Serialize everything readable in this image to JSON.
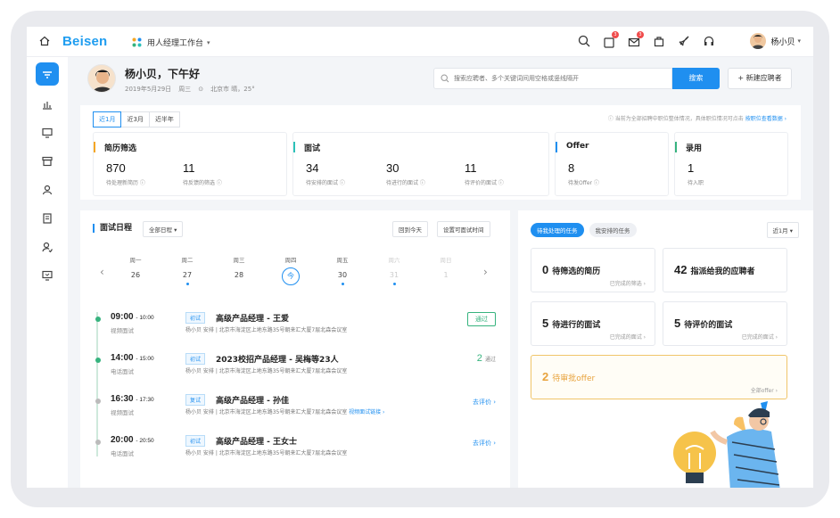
{
  "topbar": {
    "logo": "Beisen",
    "workspace": "用人经理工作台",
    "badges": {
      "mail": "3",
      "msg": "3"
    },
    "user_name": "杨小贝"
  },
  "greeting": {
    "title": "杨小贝，下午好",
    "date": "2019年5月29日",
    "weekday": "周三",
    "weather": "北京市 晴，25°"
  },
  "search": {
    "placeholder": "搜索应聘者、多个关键词间用空格或竖线隔开",
    "button": "搜索",
    "new_button": "+ 新建应聘者"
  },
  "periods": [
    "近1月",
    "近3月",
    "近半年"
  ],
  "hint": {
    "text": "当前为全部招聘中职位整体情况，具体职位情况可点击",
    "link": "按职位查看数据 ›"
  },
  "stats": [
    {
      "title": "简历筛选",
      "color": "#f5a623",
      "metrics": [
        {
          "n": "870",
          "l": "待处理新简历"
        },
        {
          "n": "11",
          "l": "待反馈的筛选"
        }
      ]
    },
    {
      "title": "面试",
      "color": "#2cc1b8",
      "metrics": [
        {
          "n": "34",
          "l": "待安排的面试"
        },
        {
          "n": "30",
          "l": "待进行的面试"
        },
        {
          "n": "11",
          "l": "待评价的面试"
        }
      ]
    },
    {
      "title": "Offer",
      "color": "#1f8ff0",
      "metrics": [
        {
          "n": "8",
          "l": "待发Offer"
        }
      ]
    },
    {
      "title": "录用",
      "color": "#36b37e",
      "metrics": [
        {
          "n": "1",
          "l": "待入职"
        }
      ]
    }
  ],
  "schedule": {
    "title": "面试日程",
    "filter": "全部日程",
    "btn_today": "回到今天",
    "btn_time": "设置可面试时间",
    "days": [
      {
        "w": "周一",
        "d": "26",
        "dot": false,
        "dim": false
      },
      {
        "w": "周二",
        "d": "27",
        "dot": true,
        "dim": false
      },
      {
        "w": "周三",
        "d": "28",
        "dot": false,
        "dim": false
      },
      {
        "w": "周四",
        "d": "今",
        "dot": false,
        "dim": false,
        "today": true
      },
      {
        "w": "周五",
        "d": "30",
        "dot": true,
        "dim": false
      },
      {
        "w": "周六",
        "d": "31",
        "dot": true,
        "dim": true
      },
      {
        "w": "周日",
        "d": "1",
        "dot": false,
        "dim": true
      }
    ],
    "events": [
      {
        "time": "09:00",
        "end": "- 10:00",
        "type": "视频面试",
        "tag": "初试",
        "name": "高级产品经理 - 王爱",
        "info": "杨小贝 安排  |  北京市海淀区上地东路35号朝来汇大厦7层北森会议室",
        "link": "",
        "action": "通过",
        "kind": "pass"
      },
      {
        "time": "14:00",
        "end": "- 15:00",
        "type": "电话面试",
        "tag": "初试",
        "name": "2023校招产品经理 - 吴梅等23人",
        "info": "杨小贝 安排  |  北京市海淀区上地东路35号朝来汇大厦7层北森会议室",
        "link": "",
        "action": "2",
        "action_sub": "通过",
        "kind": "count"
      },
      {
        "time": "16:30",
        "end": "- 17:30",
        "type": "视频面试",
        "tag": "复试",
        "name": "高级产品经理 - 孙佳",
        "info": "杨小贝 安排  |  北京市海淀区上地东路35号朝来汇大厦7层北森会议室",
        "link": "视频面试链接 ›",
        "action": "去评价 ›",
        "kind": "link"
      },
      {
        "time": "20:00",
        "end": "- 20:50",
        "type": "电话面试",
        "tag": "初试",
        "name": "高级产品经理 - 王女士",
        "info": "杨小贝 安排  |  北京市海淀区上地东路35号朝来汇大厦7层北森会议室",
        "link": "",
        "action": "去评价 ›",
        "kind": "link"
      }
    ]
  },
  "tasks": {
    "tabs": [
      "待我处理的任务",
      "我安排的任务"
    ],
    "period": "近1月",
    "cards": [
      {
        "n": "0",
        "label": "待筛选的简历",
        "sub": "已完成的筛选 ›"
      },
      {
        "n": "42",
        "label": "指派给我的应聘者",
        "sub": ""
      },
      {
        "n": "5",
        "label": "待进行的面试",
        "sub": "已完成的面试 ›"
      },
      {
        "n": "5",
        "label": "待评价的面试",
        "sub": "已完成的面试 ›"
      },
      {
        "n": "2",
        "label": "待审批offer",
        "sub": "全部offer ›"
      }
    ]
  }
}
